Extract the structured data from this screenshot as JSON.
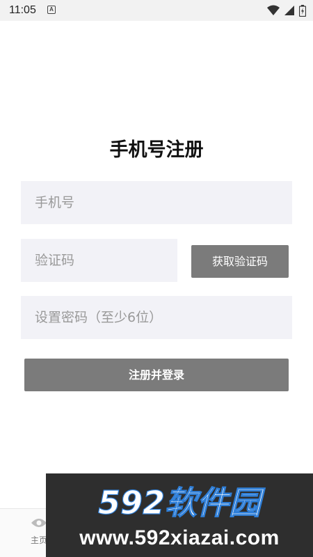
{
  "status_bar": {
    "time": "11:05",
    "notification_glyph": "A"
  },
  "title": "手机号注册",
  "form": {
    "phone_placeholder": "手机号",
    "code_placeholder": "验证码",
    "password_placeholder": "设置密码（至少6位）",
    "get_code_label": "获取验证码",
    "register_label": "注册并登录"
  },
  "tab_bar": {
    "home_label": "主页"
  },
  "watermark": {
    "logo_text": "592软件园",
    "url": "www.592xiazai.com"
  },
  "colors": {
    "button_bg": "#7b7b7b",
    "input_bg": "#f2f2f7",
    "watermark_bg": "#2e2e2e",
    "watermark_accent": "#2f7fd8"
  }
}
